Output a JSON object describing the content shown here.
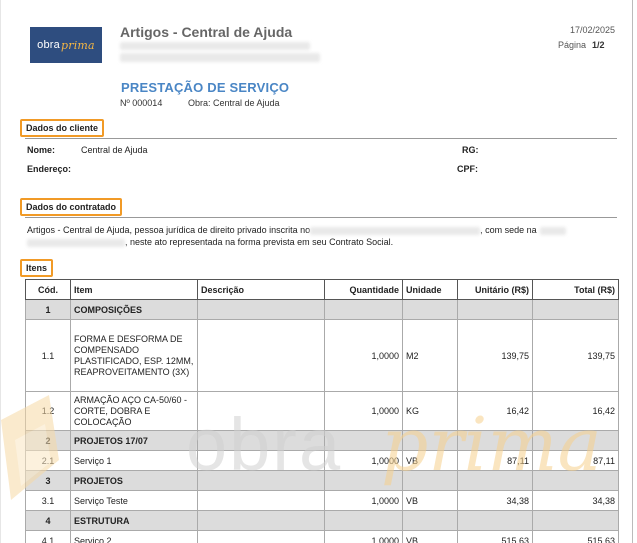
{
  "header": {
    "logo_part1": "obra",
    "logo_part2": "prima",
    "title": "Artigos - Central de Ajuda",
    "date": "17/02/2025",
    "page_label": "Página",
    "page_value": "1/2"
  },
  "document": {
    "title": "PRESTAÇÃO DE SERVIÇO",
    "number": "Nº 000014",
    "obra": "Obra: Central de Ajuda"
  },
  "client": {
    "section_label": "Dados do cliente",
    "nome_label": "Nome:",
    "nome_value": "Central de Ajuda",
    "rg_label": "RG:",
    "endereco_label": "Endereço:",
    "cpf_label": "CPF:"
  },
  "contractor": {
    "section_label": "Dados do contratado",
    "line1_a": "Artigos - Central de Ajuda, pessoa jurídica de direito privado inscrita no",
    "line1_b": ", com sede na",
    "line2": ", neste ato representada na forma prevista em seu Contrato Social."
  },
  "items": {
    "section_label": "Itens",
    "headers": {
      "cod": "Cód.",
      "item": "Item",
      "descricao": "Descrição",
      "quantidade": "Quantidade",
      "unidade": "Unidade",
      "unitario": "Unitário (R$)",
      "total": "Total (R$)"
    },
    "rows": [
      {
        "type": "group",
        "cod": "1",
        "item": "COMPOSIÇÕES"
      },
      {
        "type": "item",
        "cod": "1.1",
        "item": "FORMA E DESFORMA DE COMPENSADO PLASTIFICADO, ESP. 12MM, REAPROVEITAMENTO (3X)",
        "descricao": "",
        "quantidade": "1,0000",
        "unidade": "M2",
        "unitario": "139,75",
        "total": "139,75"
      },
      {
        "type": "item",
        "cod": "1.2",
        "item": "ARMAÇÃO AÇO CA-50/60 - CORTE, DOBRA E COLOCAÇÃO",
        "descricao": "",
        "quantidade": "1,0000",
        "unidade": "KG",
        "unitario": "16,42",
        "total": "16,42"
      },
      {
        "type": "group",
        "cod": "2",
        "item": "PROJETOS 17/07"
      },
      {
        "type": "item",
        "cod": "2.1",
        "item": "Serviço 1",
        "descricao": "",
        "quantidade": "1,0000",
        "unidade": "VB",
        "unitario": "87,11",
        "total": "87,11"
      },
      {
        "type": "group",
        "cod": "3",
        "item": "PROJETOS"
      },
      {
        "type": "item",
        "cod": "3.1",
        "item": "Serviço Teste",
        "descricao": "",
        "quantidade": "1,0000",
        "unidade": "VB",
        "unitario": "34,38",
        "total": "34,38"
      },
      {
        "type": "group",
        "cod": "4",
        "item": "ESTRUTURA"
      },
      {
        "type": "item",
        "cod": "4.1",
        "item": "Serviço 2",
        "descricao": "",
        "quantidade": "1,0000",
        "unidade": "VB",
        "unitario": "515,63",
        "total": "515,63"
      }
    ]
  },
  "watermark": {
    "part1": "obra",
    "part2": "prima",
    "color_gray": "#cfcfcf",
    "color_orange": "#f6cf8c"
  },
  "colors": {
    "accent_blue": "#4a86c5",
    "highlight_orange": "#f19a26",
    "group_row_bg": "#dcdcdc"
  }
}
